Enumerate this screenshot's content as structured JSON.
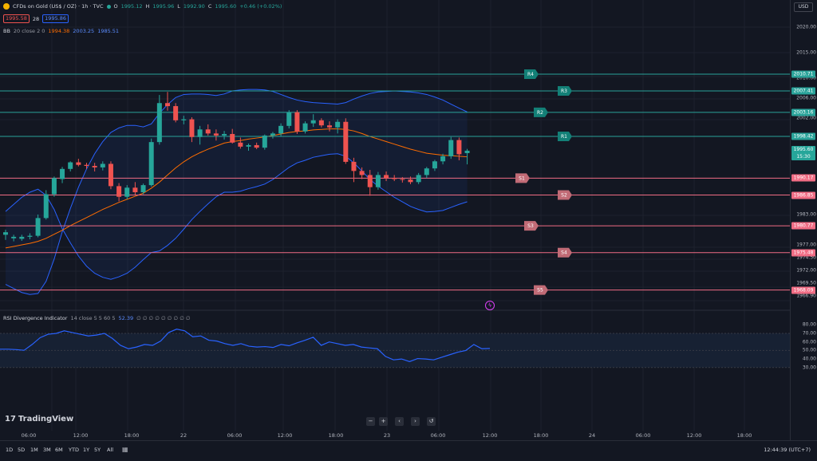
{
  "header": {
    "symbol_title": "CFDs on Gold (US$ / OZ) · 1h · TVC",
    "ohlc": {
      "o_label": "O",
      "o": "1995.12",
      "h_label": "H",
      "h": "1995.96",
      "l_label": "L",
      "l": "1992.90",
      "c_label": "C",
      "c": "1995.60",
      "change": "+0.46 (+0.02%)"
    },
    "sell_price": "1995.58",
    "spread": "28",
    "buy_price": "1995.86"
  },
  "bb_legend": {
    "name": "BB",
    "params": "20 close 2 0",
    "basis": "1994.38",
    "upper": "2003.25",
    "lower": "1985.51"
  },
  "rsi_legend": {
    "name": "RSI Divergence Indicator",
    "params": "14 close 5 5 60 5",
    "value": "52.39",
    "zeros": "∅ ∅ ∅ ∅ ∅ ∅ ∅ ∅ ∅"
  },
  "currency": "USD",
  "price_ticks": [
    "2020.00",
    "2015.00",
    "2010.00",
    "2006.00",
    "2002.00",
    "1983.00",
    "1977.00",
    "1974.50",
    "1972.00",
    "1969.50",
    "1966.90"
  ],
  "price_tags": {
    "r4": "2010.71",
    "r3": "2007.41",
    "r2": "2003.16",
    "r1": "1998.42",
    "current": "1995.60",
    "countdown": "15:30",
    "s1": "1990.17",
    "s2": "1986.85",
    "s3": "1980.77",
    "s4": "1975.48",
    "s5": "1968.09"
  },
  "level_labels": {
    "r4": "R4",
    "r3": "R3",
    "r2": "R2",
    "r1": "R1",
    "s1": "S1",
    "s2": "S2",
    "s3": "S3",
    "s4": "S4",
    "s5": "S5"
  },
  "rsi_ticks": [
    "80.00",
    "70.00",
    "60.00",
    "50.00",
    "40.00",
    "30.00"
  ],
  "time_ticks": [
    "06:00",
    "12:00",
    "18:00",
    "22",
    "06:00",
    "12:00",
    "18:00",
    "23",
    "06:00",
    "12:00",
    "18:00",
    "24",
    "06:00",
    "12:00",
    "18:00"
  ],
  "timeframes": [
    "1D",
    "5D",
    "1M",
    "3M",
    "6M",
    "YTD",
    "1Y",
    "5Y",
    "All"
  ],
  "clock": "12:44:39 (UTC+7)",
  "logo_text": "TradingView",
  "colors": {
    "up": "#26a69a",
    "down": "#ef5350",
    "resistance": "#2aa39a",
    "support": "#f06c84",
    "bb_band": "#2962ff",
    "bb_basis": "#ff6d00",
    "rsi": "#2962ff"
  },
  "chart_data": {
    "type": "candlestick",
    "symbol": "CFDs on Gold (US$ / OZ)",
    "interval": "1h",
    "price_ylim": [
      1966.9,
      2020.0
    ],
    "levels": {
      "R4": 2010.71,
      "R3": 2007.41,
      "R2": 2003.16,
      "R1": 1998.42,
      "S1": 1990.17,
      "S2": 1986.85,
      "S3": 1980.77,
      "S4": 1975.48,
      "S5": 1968.09
    },
    "candles": [
      {
        "o": 1979.0,
        "h": 1980.0,
        "l": 1978.0,
        "c": 1979.5
      },
      {
        "o": 1978.3,
        "h": 1979.0,
        "l": 1977.7,
        "c": 1978.6
      },
      {
        "o": 1978.2,
        "h": 1979.0,
        "l": 1977.8,
        "c": 1978.6
      },
      {
        "o": 1978.6,
        "h": 1979.3,
        "l": 1978.1,
        "c": 1978.8
      },
      {
        "o": 1978.8,
        "h": 1983.0,
        "l": 1978.5,
        "c": 1982.3
      },
      {
        "o": 1982.3,
        "h": 1987.8,
        "l": 1982.0,
        "c": 1987.0
      },
      {
        "o": 1987.0,
        "h": 1990.5,
        "l": 1986.5,
        "c": 1990.2
      },
      {
        "o": 1990.0,
        "h": 1992.4,
        "l": 1989.2,
        "c": 1992.0
      },
      {
        "o": 1992.0,
        "h": 1993.5,
        "l": 1991.5,
        "c": 1993.3
      },
      {
        "o": 1993.3,
        "h": 1994.0,
        "l": 1992.5,
        "c": 1992.8
      },
      {
        "o": 1992.8,
        "h": 1993.2,
        "l": 1992.0,
        "c": 1992.6
      },
      {
        "o": 1992.6,
        "h": 1993.2,
        "l": 1991.5,
        "c": 1992.3
      },
      {
        "o": 1992.3,
        "h": 1993.5,
        "l": 1991.7,
        "c": 1993.0
      },
      {
        "o": 1993.0,
        "h": 1993.5,
        "l": 1988.0,
        "c": 1988.6
      },
      {
        "o": 1988.6,
        "h": 1989.2,
        "l": 1985.6,
        "c": 1986.5
      },
      {
        "o": 1986.5,
        "h": 1988.8,
        "l": 1986.0,
        "c": 1988.3
      },
      {
        "o": 1988.3,
        "h": 1989.4,
        "l": 1986.9,
        "c": 1987.4
      },
      {
        "o": 1987.4,
        "h": 1989.1,
        "l": 1987.0,
        "c": 1988.8
      },
      {
        "o": 1988.8,
        "h": 1998.0,
        "l": 1988.5,
        "c": 1997.3
      },
      {
        "o": 1997.3,
        "h": 2006.6,
        "l": 1996.8,
        "c": 2005.0
      },
      {
        "o": 2005.0,
        "h": 2007.2,
        "l": 2003.5,
        "c": 2004.4
      },
      {
        "o": 2004.4,
        "h": 2005.0,
        "l": 2001.2,
        "c": 2001.6
      },
      {
        "o": 2001.6,
        "h": 2002.5,
        "l": 2000.8,
        "c": 2001.8
      },
      {
        "o": 2001.8,
        "h": 2002.2,
        "l": 1997.3,
        "c": 1998.3
      },
      {
        "o": 1998.3,
        "h": 2000.5,
        "l": 1996.8,
        "c": 1999.8
      },
      {
        "o": 1999.8,
        "h": 2000.8,
        "l": 1998.6,
        "c": 1999.0
      },
      {
        "o": 1999.0,
        "h": 1999.8,
        "l": 1997.6,
        "c": 1998.6
      },
      {
        "o": 1998.6,
        "h": 1999.5,
        "l": 1997.8,
        "c": 1998.9
      },
      {
        "o": 1998.9,
        "h": 1999.9,
        "l": 1997.0,
        "c": 1997.2
      },
      {
        "o": 1997.2,
        "h": 1998.2,
        "l": 1996.0,
        "c": 1996.4
      },
      {
        "o": 1996.4,
        "h": 1997.0,
        "l": 1995.6,
        "c": 1996.7
      },
      {
        "o": 1996.7,
        "h": 1997.2,
        "l": 1995.9,
        "c": 1996.2
      },
      {
        "o": 1996.2,
        "h": 1998.8,
        "l": 1995.8,
        "c": 1998.6
      },
      {
        "o": 1998.6,
        "h": 1999.3,
        "l": 1998.0,
        "c": 1999.0
      },
      {
        "o": 1999.0,
        "h": 2001.0,
        "l": 1998.5,
        "c": 2000.5
      },
      {
        "o": 2000.5,
        "h": 2003.6,
        "l": 2000.0,
        "c": 2003.2
      },
      {
        "o": 2003.2,
        "h": 2003.6,
        "l": 1998.9,
        "c": 1999.4
      },
      {
        "o": 1999.4,
        "h": 2001.4,
        "l": 1999.0,
        "c": 2001.0
      },
      {
        "o": 2001.0,
        "h": 2002.8,
        "l": 2000.3,
        "c": 2001.6
      },
      {
        "o": 2001.6,
        "h": 2002.0,
        "l": 2000.2,
        "c": 2000.6
      },
      {
        "o": 2000.6,
        "h": 2001.4,
        "l": 1999.4,
        "c": 2000.2
      },
      {
        "o": 2000.2,
        "h": 2001.8,
        "l": 1999.0,
        "c": 2001.3
      },
      {
        "o": 2001.3,
        "h": 2002.0,
        "l": 1993.0,
        "c": 1993.4
      },
      {
        "o": 1993.4,
        "h": 1994.2,
        "l": 1989.4,
        "c": 1991.6
      },
      {
        "o": 1991.6,
        "h": 1992.3,
        "l": 1990.0,
        "c": 1990.8
      },
      {
        "o": 1990.8,
        "h": 1991.8,
        "l": 1986.7,
        "c": 1988.4
      },
      {
        "o": 1988.4,
        "h": 1991.4,
        "l": 1987.9,
        "c": 1990.8
      },
      {
        "o": 1990.8,
        "h": 1991.5,
        "l": 1989.6,
        "c": 1990.2
      },
      {
        "o": 1990.2,
        "h": 1990.8,
        "l": 1989.6,
        "c": 1990.0
      },
      {
        "o": 1990.0,
        "h": 1990.4,
        "l": 1989.3,
        "c": 1989.9
      },
      {
        "o": 1989.9,
        "h": 1990.5,
        "l": 1989.0,
        "c": 1989.4
      },
      {
        "o": 1989.4,
        "h": 1991.2,
        "l": 1989.0,
        "c": 1990.8
      },
      {
        "o": 1990.8,
        "h": 1992.4,
        "l": 1990.2,
        "c": 1992.1
      },
      {
        "o": 1992.1,
        "h": 1993.8,
        "l": 1991.6,
        "c": 1993.5
      },
      {
        "o": 1993.5,
        "h": 1995.0,
        "l": 1992.9,
        "c": 1994.5
      },
      {
        "o": 1994.5,
        "h": 1998.3,
        "l": 1994.0,
        "c": 1997.7
      },
      {
        "o": 1997.7,
        "h": 1998.2,
        "l": 1993.7,
        "c": 1994.9
      },
      {
        "o": 1995.12,
        "h": 1995.96,
        "l": 1992.9,
        "c": 1995.6
      }
    ],
    "bb_upper": [
      1969.2,
      1968.4,
      1967.6,
      1967.2,
      1967.4,
      1969.8,
      1974.2,
      1979.6,
      1984.2,
      1988.4,
      1992.0,
      1995.0,
      1997.4,
      1999.2,
      2000.1,
      2000.6,
      2000.6,
      2000.3,
      2000.9,
      2003.0,
      2004.7,
      2006.1,
      2006.7,
      2006.8,
      2006.8,
      2006.7,
      2006.5,
      2006.8,
      2007.4,
      2007.6,
      2007.7,
      2007.7,
      2007.6,
      2007.3,
      2006.7,
      2006.1,
      2005.6,
      2005.3,
      2005.1,
      2005.0,
      2004.9,
      2004.8,
      2005.1,
      2005.8,
      2006.4,
      2006.9,
      2007.2,
      2007.3,
      2007.4,
      2007.3,
      2007.2,
      2007.0,
      2006.7,
      2006.2,
      2005.6,
      2004.8,
      2004.0,
      2003.25
    ],
    "bb_basis": [
      1976.4,
      1976.7,
      1977.0,
      1977.3,
      1977.7,
      1978.3,
      1979.1,
      1979.9,
      1980.8,
      1981.6,
      1982.4,
      1983.2,
      1984.0,
      1984.7,
      1985.4,
      1986.0,
      1986.6,
      1987.2,
      1988.2,
      1989.4,
      1990.8,
      1992.2,
      1993.4,
      1994.4,
      1995.2,
      1995.9,
      1996.5,
      1997.1,
      1997.4,
      1997.6,
      1997.9,
      1998.1,
      1998.3,
      1998.6,
      1998.9,
      1999.2,
      1999.4,
      1999.5,
      1999.7,
      1999.8,
      1999.9,
      1999.9,
      1999.8,
      1999.5,
      1999.0,
      1998.4,
      1997.9,
      1997.4,
      1996.9,
      1996.4,
      1995.9,
      1995.5,
      1995.1,
      1994.9,
      1994.7,
      1994.6,
      1994.5,
      1994.38
    ],
    "bb_lower": [
      1983.6,
      1985.0,
      1986.4,
      1987.4,
      1988.0,
      1986.8,
      1984.0,
      1980.2,
      1977.4,
      1974.8,
      1972.8,
      1971.4,
      1970.6,
      1970.2,
      1970.7,
      1971.4,
      1972.6,
      1974.1,
      1975.5,
      1975.8,
      1976.9,
      1978.3,
      1980.1,
      1982.0,
      1983.6,
      1985.1,
      1986.5,
      1987.4,
      1987.4,
      1987.6,
      1988.1,
      1988.5,
      1989.0,
      1989.9,
      1991.1,
      1992.3,
      1993.2,
      1993.7,
      1994.3,
      1994.6,
      1994.9,
      1995.0,
      1994.5,
      1993.2,
      1991.6,
      1989.9,
      1988.6,
      1987.5,
      1986.4,
      1985.5,
      1984.6,
      1984.0,
      1983.5,
      1983.6,
      1983.8,
      1984.4,
      1985.0,
      1985.51
    ],
    "rsi_ylim": [
      30,
      80
    ],
    "rsi": [
      51.5,
      51.5,
      51,
      50.2,
      57,
      65,
      69,
      70,
      73,
      71,
      69,
      67,
      68,
      70,
      64,
      56,
      52,
      54,
      57,
      56,
      61,
      71,
      75,
      73,
      66,
      67,
      62,
      61,
      58,
      56,
      58,
      55,
      54,
      54.5,
      53.5,
      57,
      55.5,
      59,
      62,
      65.5,
      56,
      60,
      58,
      56,
      57,
      54,
      53,
      52,
      43,
      39,
      40,
      37,
      40.5,
      40,
      39,
      42,
      45,
      48,
      50,
      57,
      52,
      52.39
    ]
  }
}
